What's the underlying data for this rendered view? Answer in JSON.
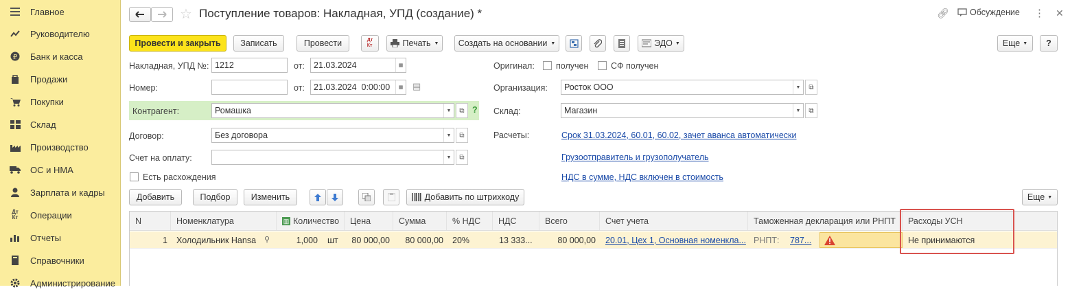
{
  "sidebar": {
    "items": [
      {
        "label": "Главное",
        "icon": "menu-icon"
      },
      {
        "label": "Руководителю",
        "icon": "trend-icon"
      },
      {
        "label": "Банк и касса",
        "icon": "ruble-icon"
      },
      {
        "label": "Продажи",
        "icon": "bag-icon"
      },
      {
        "label": "Покупки",
        "icon": "cart-icon"
      },
      {
        "label": "Склад",
        "icon": "warehouse-icon"
      },
      {
        "label": "Производство",
        "icon": "factory-icon"
      },
      {
        "label": "ОС и НМА",
        "icon": "truck-icon"
      },
      {
        "label": "Зарплата и кадры",
        "icon": "person-icon"
      },
      {
        "label": "Операции",
        "icon": "dt-kt-icon"
      },
      {
        "label": "Отчеты",
        "icon": "bar-chart-icon"
      },
      {
        "label": "Справочники",
        "icon": "book-icon"
      },
      {
        "label": "Администрирование",
        "icon": "gear-icon"
      }
    ]
  },
  "header": {
    "title": "Поступление товаров: Накладная, УПД (создание) *",
    "discussion": "Обсуждение"
  },
  "toolbar": {
    "post_close": "Провести и закрыть",
    "save": "Записать",
    "post": "Провести",
    "dtkt": "Дт Кт",
    "print": "Печать",
    "create_based": "Создать на основании",
    "edo": "ЭДО",
    "more": "Еще",
    "help": "?"
  },
  "form": {
    "invoice_label": "Накладная, УПД №:",
    "invoice_value": "1212",
    "from_label": "от:",
    "invoice_date": "21.03.2024",
    "number_label": "Номер:",
    "number_value": "",
    "date2": "21.03.2024  0:00:00",
    "counterparty_label": "Контрагент:",
    "counterparty_value": "Ромашка",
    "help_mark": "?",
    "contract_label": "Договор:",
    "contract_value": "Без договора",
    "payment_label": "Счет на оплату:",
    "payment_value": "",
    "discrepancy_label": "Есть расхождения",
    "original_label": "Оригинал:",
    "received_label": "получен",
    "sf_received_label": "СФ получен",
    "org_label": "Организация:",
    "org_value": "Росток ООО",
    "warehouse_label": "Склад:",
    "warehouse_value": "Магазин",
    "settlements_label": "Расчеты:",
    "settlements_link": "Срок 31.03.2024, 60.01, 60.02, зачет аванса автоматически",
    "shipper_link": "Грузоотправитель и грузополучатель",
    "vat_link": "НДС в сумме, НДС включен в стоимость"
  },
  "table_toolbar": {
    "add": "Добавить",
    "pick": "Подбор",
    "edit": "Изменить",
    "barcode": "Добавить по штрихкоду",
    "more": "Еще"
  },
  "table": {
    "headers": [
      "N",
      "Номенклатура",
      "Количество",
      "Цена",
      "Сумма",
      "% НДС",
      "НДС",
      "Всего",
      "Счет учета",
      "Таможенная декларация или РНПТ",
      "Расходы УСН"
    ],
    "rows": [
      {
        "n": "1",
        "item": "Холодильник Hansa",
        "qty": "1,000",
        "unit": "шт",
        "price": "80 000,00",
        "sum": "80 000,00",
        "vat_rate": "20%",
        "vat": "13 333...",
        "total": "80 000,00",
        "account": "20.01, Цех 1, Основная номенкла...",
        "rnpt_label": "РНПТ:",
        "rnpt_value": "787...",
        "usn": "Не принимаются"
      }
    ]
  },
  "colors": {
    "sidebar_bg": "#fbed9e",
    "primary_button": "#fce31b",
    "highlight_row": "#fdf3d2",
    "link": "#1a4aa8",
    "annotation_border": "#d9534f"
  }
}
